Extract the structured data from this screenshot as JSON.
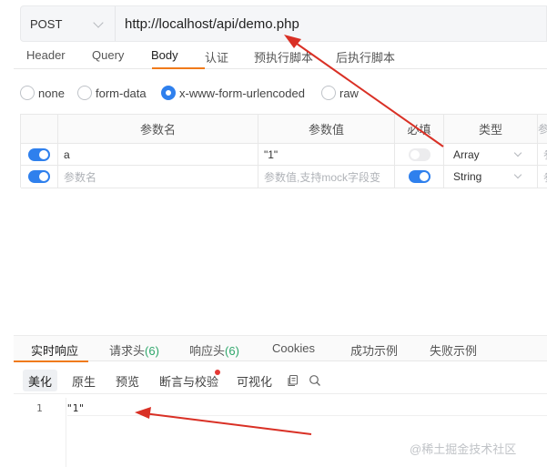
{
  "request": {
    "method": "POST",
    "url": "http://localhost/api/demo.php"
  },
  "tabs": [
    "Header",
    "Query",
    "Body",
    "认证",
    "预执行脚本",
    "后执行脚本"
  ],
  "active_tab": "Body",
  "body_types": [
    {
      "label": "none",
      "selected": false
    },
    {
      "label": "form-data",
      "selected": false
    },
    {
      "label": "x-www-form-urlencoded",
      "selected": true
    },
    {
      "label": "raw",
      "selected": false
    }
  ],
  "params_table": {
    "headers": [
      "参数名",
      "参数值",
      "必填",
      "类型",
      "参"
    ],
    "rows": [
      {
        "enabled": true,
        "name": "a",
        "value": "\"1\"",
        "required": false,
        "type": "Array",
        "desc": "参"
      },
      {
        "enabled": true,
        "name_placeholder": "参数名",
        "value_placeholder": "参数值,支持mock字段变",
        "required": true,
        "type": "String",
        "desc": "参"
      }
    ]
  },
  "response": {
    "tabs": [
      {
        "label": "实时响应",
        "count": ""
      },
      {
        "label": "请求头",
        "count": "(6)"
      },
      {
        "label": "响应头",
        "count": "(6)"
      },
      {
        "label": "Cookies",
        "count": ""
      },
      {
        "label": "成功示例",
        "count": ""
      },
      {
        "label": "失败示例",
        "count": ""
      }
    ],
    "toolbar": [
      "美化",
      "原生",
      "预览",
      "断言与校验",
      "可视化"
    ],
    "line_number": "1",
    "body": "\"1\""
  },
  "watermark": "@稀土掘金技术社区",
  "colors": {
    "accent": "#2f80ed",
    "tab_underline": "#f07a1a",
    "count_green": "#2ea66a",
    "annotation_arrow": "#d93025"
  }
}
